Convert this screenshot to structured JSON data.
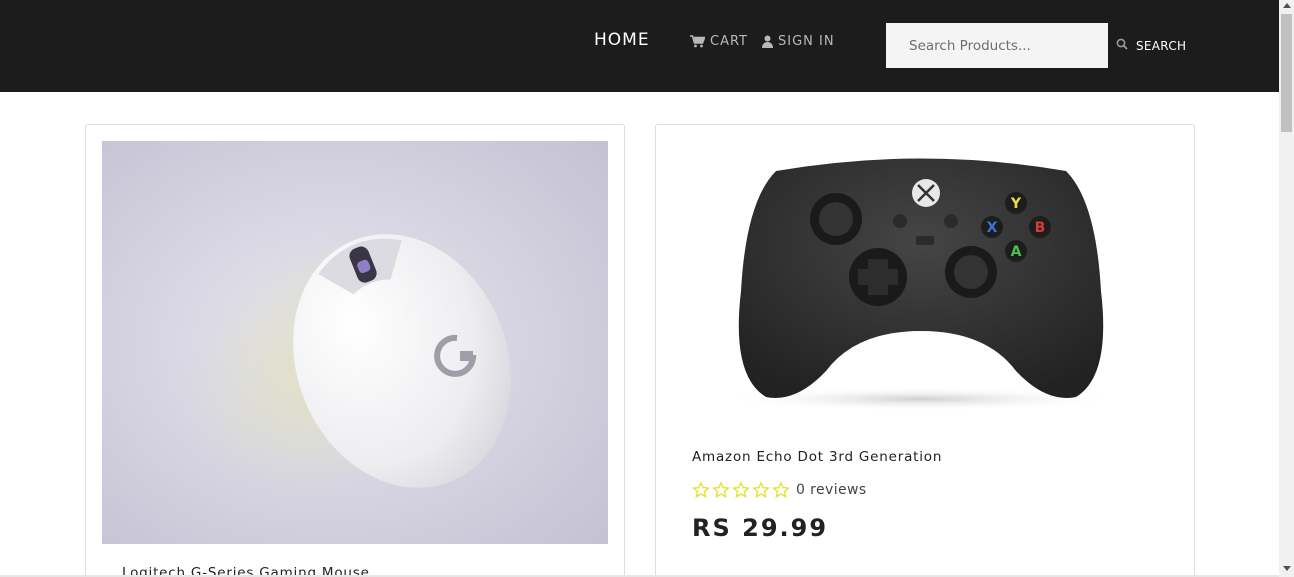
{
  "nav": {
    "home_label": "HOME",
    "cart_label": "CART",
    "signin_label": "SIGN IN",
    "cart_icon": "shopping-cart-icon",
    "signin_icon": "user-icon"
  },
  "search": {
    "placeholder": "Search Products...",
    "value": "",
    "button_label": "SEARCH",
    "icon": "search-icon"
  },
  "products": [
    {
      "name": "Logitech G-Series Gaming Mouse",
      "image": "white-gaming-mouse-photo"
    },
    {
      "name": "Amazon Echo Dot 3rd Generation",
      "image": "black-game-controller-photo",
      "rating": 0,
      "reviews_label": "0 reviews",
      "price": "RS 29.99"
    }
  ],
  "colors": {
    "navbar": "#1c1c1c",
    "star_outline": "#e2e22a",
    "text": "#222222"
  }
}
